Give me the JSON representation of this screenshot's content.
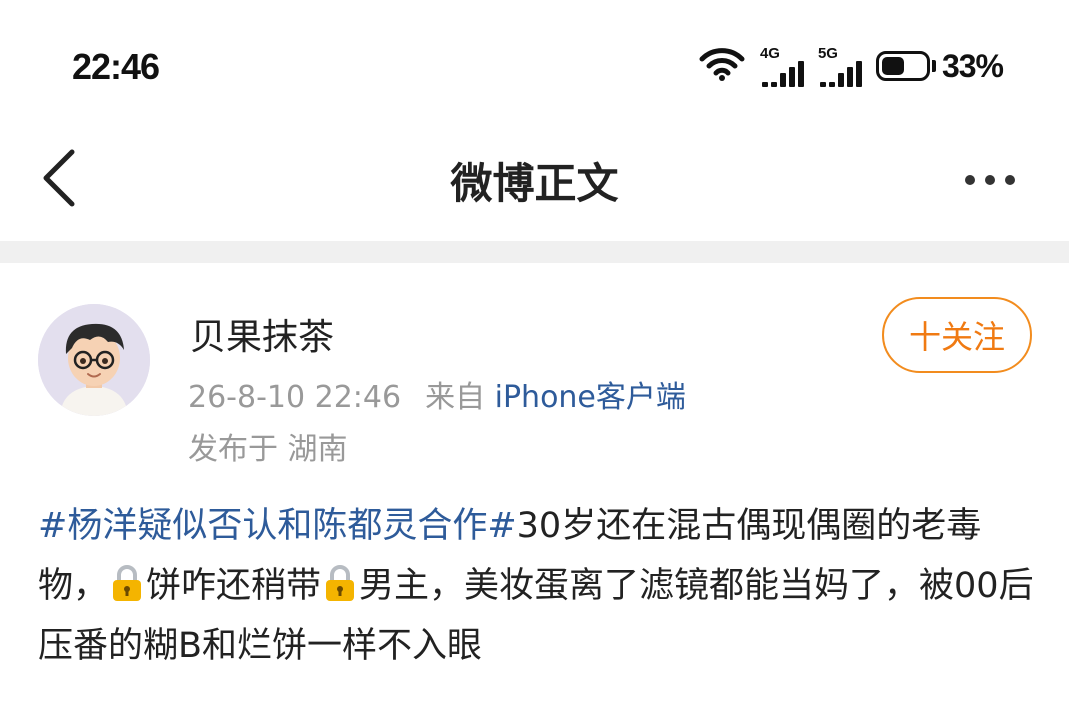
{
  "status_bar": {
    "time": "22:46",
    "net1": "4G",
    "net2": "5G",
    "battery_percent": "33%",
    "battery_level": 0.33,
    "icons": [
      "wifi-icon",
      "signal-4g-icon",
      "signal-5g-icon",
      "battery-icon"
    ]
  },
  "nav": {
    "title": "微博正文",
    "back_icon": "chevron-left-icon",
    "more_icon": "more-dots-icon"
  },
  "post": {
    "author": "贝果抹茶",
    "time": "26-8-10 22:46",
    "source_prefix": "来自",
    "source": "iPhone客户端",
    "location": "发布于 湖南",
    "follow_label": "十关注",
    "topic": "#杨洋疑似否认和陈都灵合作#",
    "text_a": "30岁还在混古偶现偶圈的老毒物，",
    "text_b": "饼咋还稍带",
    "text_c": "男主，美妆蛋离了滤镜都能当妈了，被00后压番的糊B和烂饼一样不入眼",
    "inline_icon": "lock-emoji-icon"
  },
  "colors": {
    "link": "#2e5b9a",
    "accent_orange": "#f07a12",
    "meta_gray": "#999999",
    "divider": "#f0f0f0"
  }
}
